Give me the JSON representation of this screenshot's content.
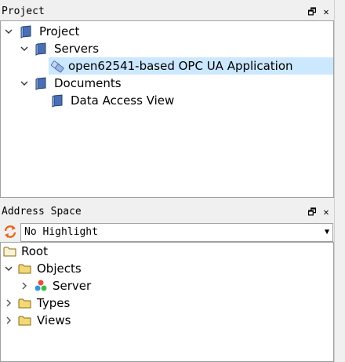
{
  "project_panel": {
    "title": "Project",
    "float_glyph": "🗗",
    "close_glyph": "✕",
    "tree": [
      {
        "label": "Project",
        "expanded": true
      },
      {
        "label": "Servers",
        "expanded": true
      },
      {
        "label": "open62541-based OPC UA Application",
        "selected": true
      },
      {
        "label": "Documents",
        "expanded": true
      },
      {
        "label": "Data Access View"
      }
    ]
  },
  "address_panel": {
    "title": "Address Space",
    "float_glyph": "🗗",
    "close_glyph": "✕",
    "highlight_select": {
      "value": "No Highlight",
      "arrow": "▼"
    },
    "tree": [
      {
        "label": "Root"
      },
      {
        "label": "Objects",
        "expanded": true
      },
      {
        "label": "Server",
        "expanded": false
      },
      {
        "label": "Types",
        "expanded": false
      },
      {
        "label": "Views",
        "expanded": false
      }
    ]
  },
  "colors": {
    "selection": "#cce8ff",
    "folder": "#e8c25a",
    "book": "#4a6fb5"
  }
}
